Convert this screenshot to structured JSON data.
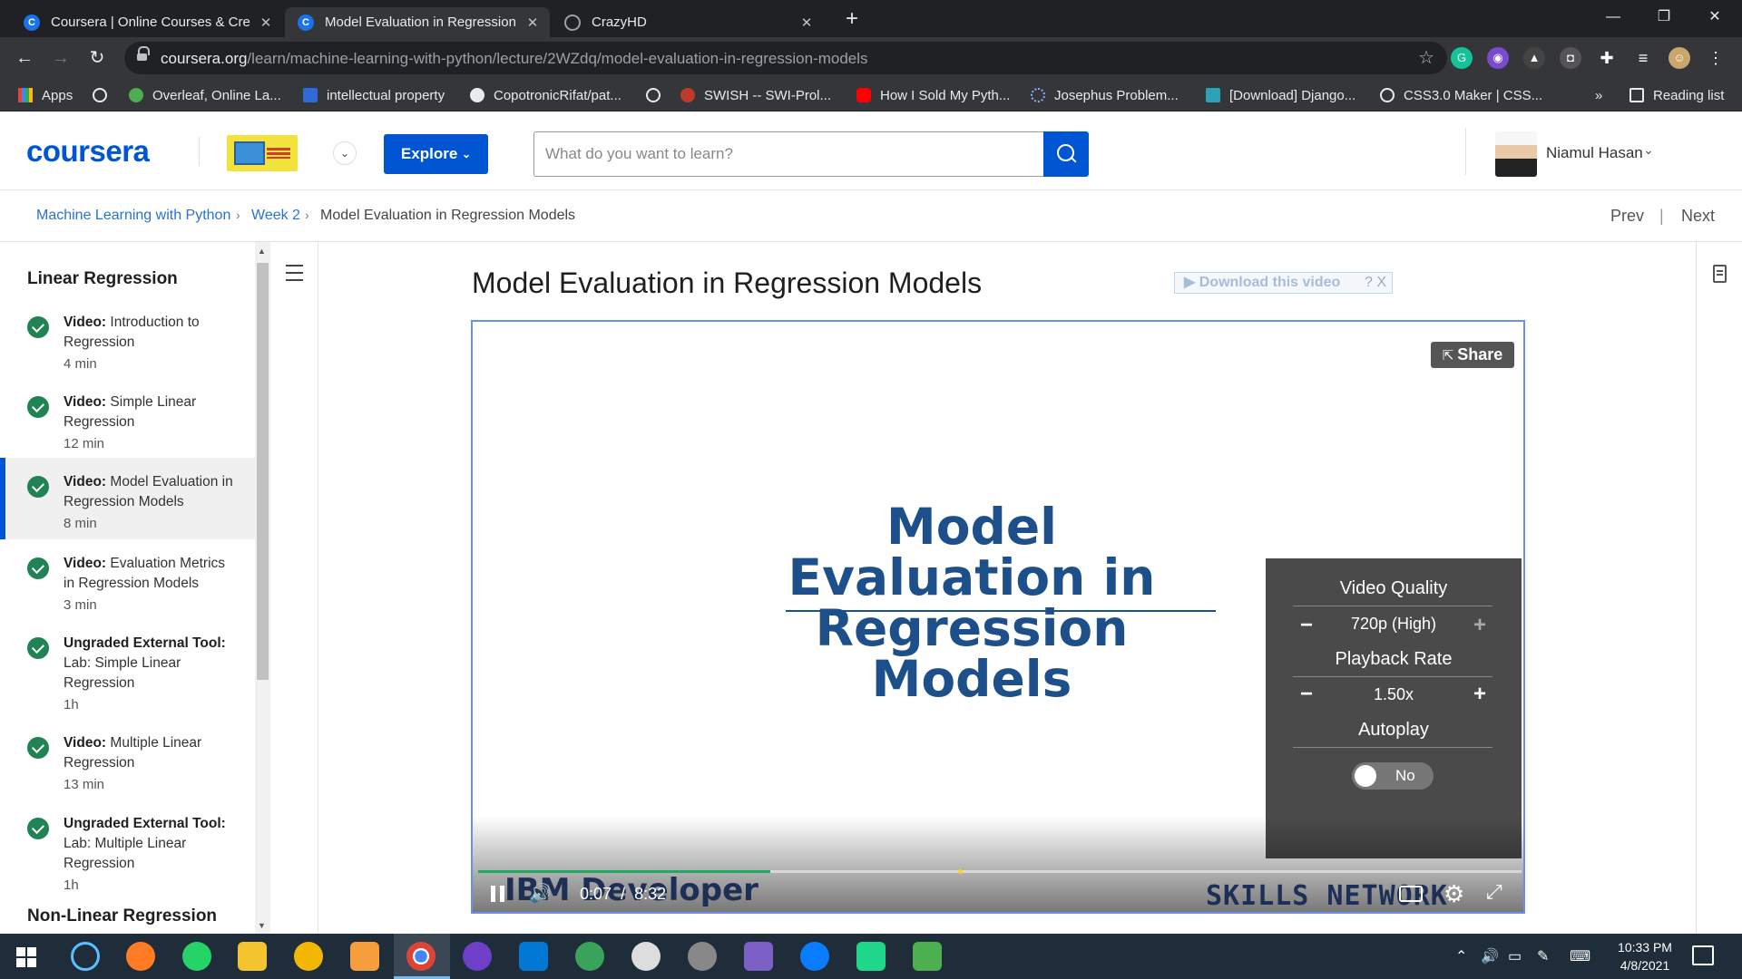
{
  "browser": {
    "tabs": [
      {
        "title": "Coursera | Online Courses & Cre",
        "icon": "coursera-favicon",
        "active": false
      },
      {
        "title": "Model Evaluation in Regression M",
        "icon": "coursera-favicon",
        "active": true
      },
      {
        "title": "CrazyHD",
        "icon": "globe-icon",
        "active": false
      }
    ],
    "url_host": "coursera.org",
    "url_path": "/learn/machine-learning-with-python/lecture/2WZdq/model-evaluation-in-regression-models",
    "bookmarks": [
      "Apps",
      "",
      "Overleaf, Online La...",
      "intellectual property",
      "CopotronicRifat/pat...",
      "",
      "SWISH -- SWI-Prol...",
      "How I Sold My Pyth...",
      "Josephus Problem...",
      "[Download] Django...",
      "CSS3.0 Maker | CSS..."
    ],
    "overflow_label": "»",
    "reading_list": "Reading list"
  },
  "header": {
    "logo": "coursera",
    "explore_label": "Explore",
    "search_placeholder": "What do you want to learn?",
    "user_name": "Niamul Hasan"
  },
  "breadcrumb": {
    "course": "Machine Learning with Python",
    "week": "Week 2",
    "current": "Model Evaluation in Regression Models",
    "prev": "Prev",
    "separator": "|",
    "next": "Next"
  },
  "sidebar": {
    "section1": "Linear Regression",
    "items": [
      {
        "kind": "Video:",
        "title": "Introduction to Regression",
        "duration": "4 min"
      },
      {
        "kind": "Video:",
        "title": "Simple Linear Regression",
        "duration": "12 min"
      },
      {
        "kind": "Video:",
        "title": "Model Evaluation in Regression Models",
        "duration": "8 min"
      },
      {
        "kind": "Video:",
        "title": "Evaluation Metrics in Regression Models",
        "duration": "3 min"
      },
      {
        "kind": "Ungraded External Tool:",
        "title": "Lab: Simple Linear Regression",
        "duration": "1h"
      },
      {
        "kind": "Video:",
        "title": "Multiple Linear Regression",
        "duration": "13 min"
      },
      {
        "kind": "Ungraded External Tool:",
        "title": "Lab: Multiple Linear Regression",
        "duration": "1h"
      }
    ],
    "section2": "Non-Linear Regression"
  },
  "lecture": {
    "title": "Model Evaluation in Regression Models",
    "download_label": "▶ Download this video",
    "download_help": "?",
    "download_close": "X"
  },
  "player": {
    "slide_title": "Model Evaluation in Regression Models",
    "share_label": "Share",
    "brand_left": "IBM Developer",
    "brand_right": "SKILLS NETWORK",
    "current_time": "0:07",
    "time_sep": "/",
    "duration": "8:32",
    "progress": 0.28,
    "settings": {
      "quality_label": "Video Quality",
      "quality_value": "720p (High)",
      "rate_label": "Playback Rate",
      "rate_value": "1.50x",
      "autoplay_label": "Autoplay",
      "autoplay_value": "No",
      "minus": "−",
      "plus": "+"
    }
  },
  "taskbar": {
    "time": "10:33 PM",
    "date": "4/8/2021"
  },
  "colors": {
    "brand_blue": "#0056d2",
    "complete_green": "#1f8354",
    "slide_title": "#1d4f8a"
  }
}
